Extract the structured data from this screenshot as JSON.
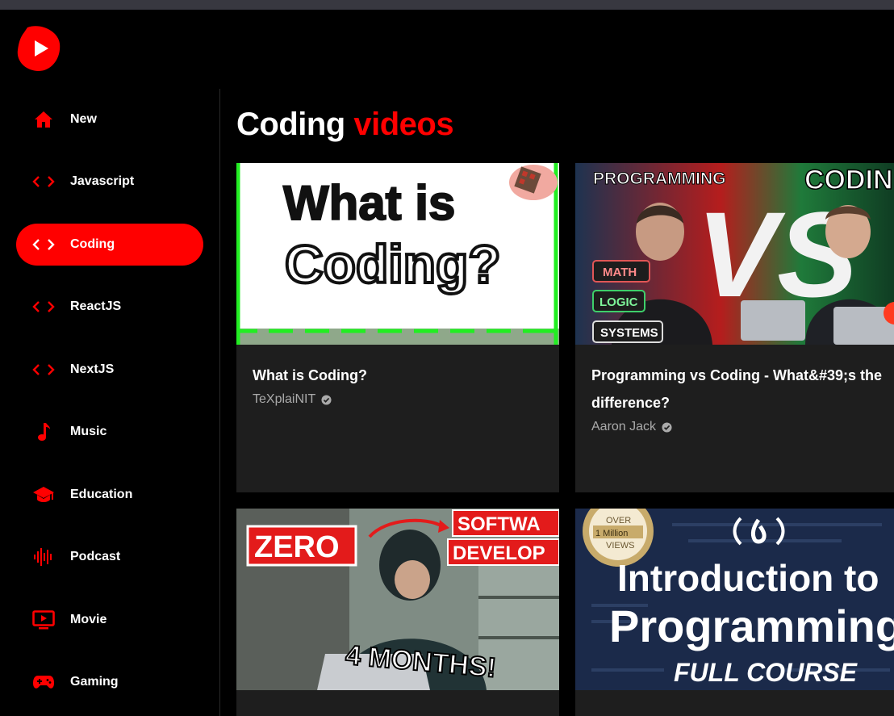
{
  "app": {
    "logo_icon": "youtube-play-icon",
    "logo_text": "YT",
    "brand_color": "#ff0000"
  },
  "sidebar": {
    "items": [
      {
        "label": "New",
        "icon": "home-icon",
        "active": false
      },
      {
        "label": "Javascript",
        "icon": "code-icon",
        "active": false
      },
      {
        "label": "Coding",
        "icon": "code-icon",
        "active": true
      },
      {
        "label": "ReactJS",
        "icon": "code-icon",
        "active": false
      },
      {
        "label": "NextJS",
        "icon": "code-icon",
        "active": false
      },
      {
        "label": "Music",
        "icon": "music-note-icon",
        "active": false
      },
      {
        "label": "Education",
        "icon": "graduation-cap-icon",
        "active": false
      },
      {
        "label": "Podcast",
        "icon": "soundwave-icon",
        "active": false
      },
      {
        "label": "Movie",
        "icon": "tv-play-icon",
        "active": false
      },
      {
        "label": "Gaming",
        "icon": "gamepad-icon",
        "active": false
      }
    ]
  },
  "feed": {
    "heading_main": "Coding",
    "heading_accent": "videos",
    "videos": [
      {
        "title": "What is Coding?",
        "channel": "TeXplaiNIT",
        "verified": true,
        "thumbnail_text": [
          "What is",
          "Coding?"
        ]
      },
      {
        "title": "Programming vs Coding - What&#39;s the difference?",
        "channel": "Aaron Jack",
        "verified": true,
        "thumbnail_text": [
          "PROGRAMMING",
          "VS",
          "CODIN",
          "MATH",
          "LOGIC",
          "SYSTEMS"
        ]
      },
      {
        "title": "",
        "channel": "",
        "verified": false,
        "thumbnail_text": [
          "ZERO",
          "SOFTWA",
          "DEVELOP",
          "4 MONTHS!"
        ]
      },
      {
        "title": "",
        "channel": "",
        "verified": false,
        "thumbnail_text": [
          "OVER",
          "1 Million",
          "VIEWS",
          "Introduction to",
          "Programming",
          "FULL COURSE"
        ]
      }
    ]
  }
}
